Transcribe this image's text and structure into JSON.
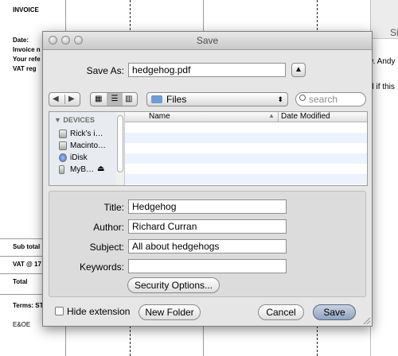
{
  "spreadsheet": {
    "invoice_title": "INVOICE",
    "date_label": "Date:",
    "invoice_no_label": "Invoice n",
    "your_ref_label": "Your refe",
    "vat_reg_label": "VAT reg",
    "subtotal_label": "Sub total",
    "vat_label": "VAT @ 17",
    "total_label": "Total",
    "terms_label": "Terms: ST",
    "eoe_label": "E&OE"
  },
  "right_doc": {
    "header_text": "Si",
    "text1": "w. Andy",
    "text2": "al if this"
  },
  "dialog": {
    "title": "Save",
    "save_as_label": "Save As:",
    "save_as_value": "hedgehog.pdf",
    "expand_icon": "triangle-up-icon",
    "location": "Files",
    "search_placeholder": "search",
    "sidebar_section": "DEVICES",
    "devices": [
      {
        "label": "Rick’s i…",
        "icon": "computer-icon"
      },
      {
        "label": "Macinto…",
        "icon": "hard-drive-icon"
      },
      {
        "label": "iDisk",
        "icon": "idisk-icon"
      },
      {
        "label": "MyB…",
        "icon": "external-drive-icon"
      }
    ],
    "columns": {
      "name": "Name",
      "date": "Date Modified"
    },
    "pdf_options": {
      "title_label": "Title:",
      "title_value": "Hedgehog",
      "author_label": "Author:",
      "author_value": "Richard Curran",
      "subject_label": "Subject:",
      "subject_value": "All about hedgehogs",
      "keywords_label": "Keywords:",
      "keywords_value": "",
      "security_button": "Security Options..."
    },
    "hide_extension_label": "Hide extension",
    "hide_extension_checked": false,
    "new_folder_button": "New Folder",
    "cancel_button": "Cancel",
    "save_button": "Save",
    "colors": {
      "default_button": "#8fa2bf",
      "folder": "#6f9bd6",
      "sidebar_bg": "#e8ebef"
    }
  }
}
